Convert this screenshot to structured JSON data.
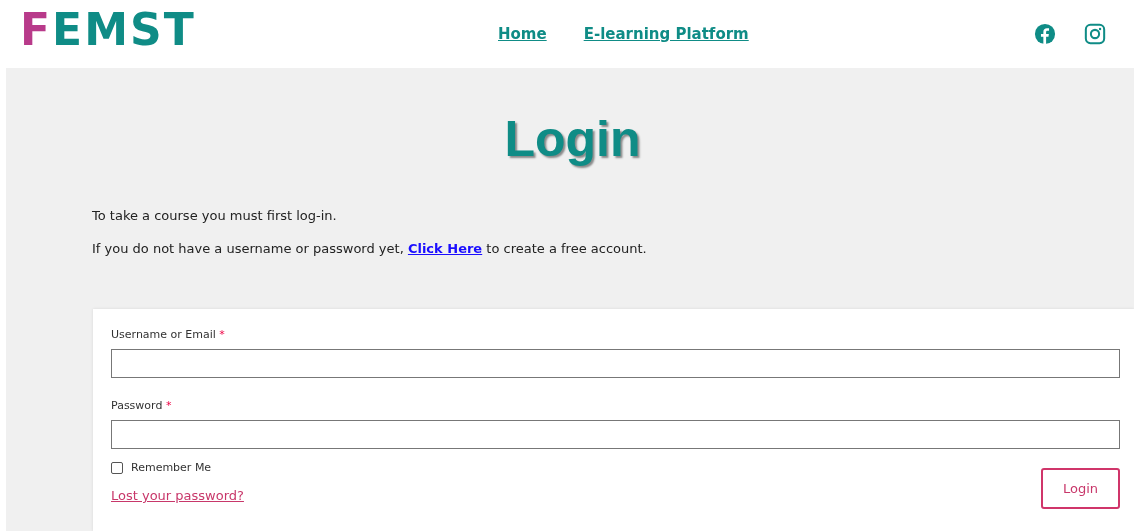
{
  "header": {
    "logo": "FEMST",
    "nav": [
      {
        "label": "Home"
      },
      {
        "label": "E-learning Platform"
      }
    ]
  },
  "title": "Login",
  "intro": "To take a course you must first log-in.",
  "signup": {
    "before": "If you do not have a username or password yet,",
    "link": "Click Here",
    "after": "to create a free account."
  },
  "form": {
    "fields": [
      {
        "label": "Username or Email",
        "required_mark": "*"
      },
      {
        "label": "Password",
        "required_mark": "*"
      }
    ],
    "remember": {
      "label": "Remember Me",
      "checked": false
    },
    "lost_password": "Lost your password?",
    "submit": "Login"
  }
}
